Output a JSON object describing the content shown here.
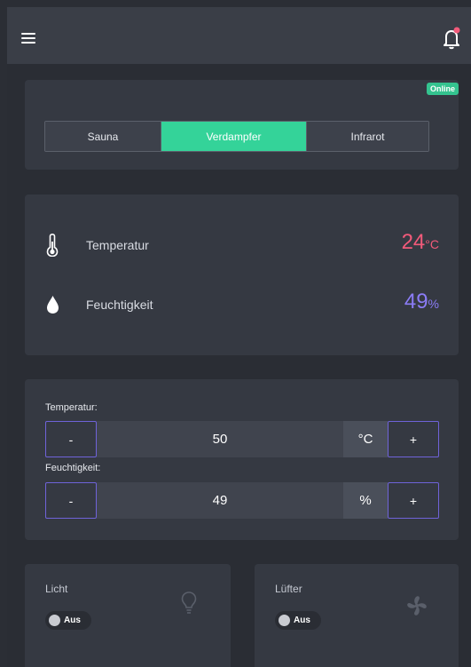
{
  "colors": {
    "accent": "#34d399",
    "online": "#34c38f",
    "temperature": "#f25a7a",
    "humidity": "#8b7cf6",
    "stepper_border": "#6f63d9"
  },
  "header": {
    "menu_icon": "hamburger-menu-icon",
    "notification_icon": "bell-icon"
  },
  "mode": {
    "status_badge": "Online",
    "tabs": [
      {
        "label": "Sauna",
        "active": false
      },
      {
        "label": "Verdampfer",
        "active": true
      },
      {
        "label": "Infrarot",
        "active": false
      }
    ]
  },
  "readings": {
    "temperature": {
      "label": "Temperatur",
      "value": "24",
      "unit": "°C",
      "icon": "thermometer-icon"
    },
    "humidity": {
      "label": "Feuchtigkeit",
      "value": "49",
      "unit": "%",
      "icon": "water-drop-icon"
    }
  },
  "setpoints": {
    "temperature": {
      "label": "Temperatur:",
      "value": "50",
      "unit": "°C",
      "minus": "-",
      "plus": "+"
    },
    "humidity": {
      "label": "Feuchtigkeit:",
      "value": "49",
      "unit": "%",
      "minus": "-",
      "plus": "+"
    }
  },
  "devices": {
    "light": {
      "title": "Licht",
      "toggle_label": "Aus",
      "icon": "lightbulb-icon"
    },
    "fan": {
      "title": "Lüfter",
      "toggle_label": "Aus",
      "icon": "fan-icon"
    }
  }
}
